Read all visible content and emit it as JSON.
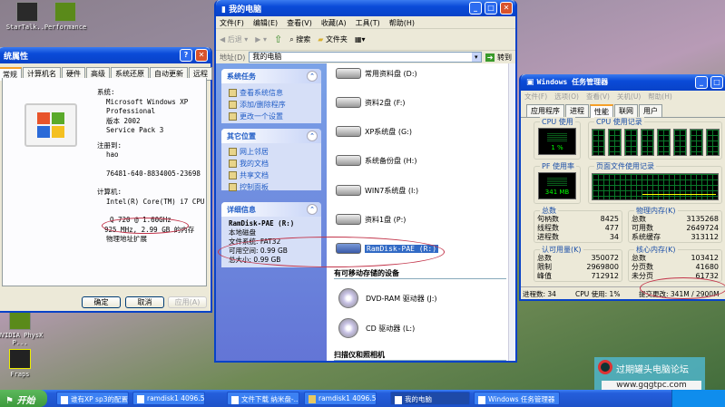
{
  "desktop": {
    "icons": [
      {
        "label": "StarTalk...",
        "icon": "startalk-shortcut-icon"
      },
      {
        "label": "Performance",
        "icon": "nvidia-performance-icon"
      },
      {
        "label": "NVIDIA PhysX P...",
        "icon": "nvidia-physx-icon"
      },
      {
        "label": "Fraps",
        "icon": "fraps-icon"
      }
    ]
  },
  "sysprops": {
    "title": "统属性",
    "tabs": [
      "常规",
      "计算机名",
      "硬件",
      "高级",
      "系统还原",
      "自动更新",
      "远程"
    ],
    "active_tab": "常规",
    "system_label": "系统:",
    "system_lines": [
      "Microsoft Windows XP",
      "Professional",
      "版本 2002",
      "Service Pack 3"
    ],
    "registered_label": "注册到:",
    "registered_user": "hao",
    "product_id": "76481-640-8834005-23698",
    "computer_label": "计算机:",
    "computer_lines": [
      "Intel(R) Core(TM) i7 CPU",
      "Q 720  @ 1.60GHz",
      "925 MHz, 2.99 GB 的内存",
      "物理地址扩展"
    ],
    "buttons": {
      "ok": "确定",
      "cancel": "取消",
      "apply": "应用(A)"
    }
  },
  "explorer": {
    "title": "我的电脑",
    "menu": [
      "文件(F)",
      "编辑(E)",
      "查看(V)",
      "收藏(A)",
      "工具(T)",
      "帮助(H)"
    ],
    "toolbar": {
      "back": "后退",
      "search": "搜索",
      "folders": "文件夹"
    },
    "address_label": "地址(D)",
    "address_value": "我的电脑",
    "go_label": "转到",
    "panels": {
      "system_tasks": {
        "title": "系统任务",
        "items": [
          "查看系统信息",
          "添加/删除程序",
          "更改一个设置"
        ]
      },
      "other_places": {
        "title": "其它位置",
        "items": [
          "网上邻居",
          "我的文档",
          "共享文档",
          "控制面板"
        ]
      },
      "details": {
        "title": "详细信息",
        "name": "RamDisk-PAE (R:)",
        "type": "本地磁盘",
        "fs": "文件系统: FAT32",
        "free": "可用空间: 0.99 GB",
        "total": "总大小: 0.99 GB"
      }
    },
    "drives": [
      "常用资料盘 (D:)",
      "资料2盘 (F:)",
      "XP系统盘 (G:)",
      "系统备份盘 (H:)",
      "WIN7系统盘 (I:)",
      "资料1盘 (P:)",
      "RamDisk-PAE (R:)"
    ],
    "selected_drive": "RamDisk-PAE (R:)",
    "removable_header": "有可移动存储的设备",
    "removable": [
      "DVD-RAM 驱动器 (J:)",
      "CD 驱动器 (L:)"
    ],
    "scanner_header": "扫描仪和照相机"
  },
  "taskmgr": {
    "title": "Windows 任务管理器",
    "menu": [
      "文件(F)",
      "选项(O)",
      "查看(V)",
      "关机(U)",
      "帮助(H)"
    ],
    "tabs": [
      "应用程序",
      "进程",
      "性能",
      "联网",
      "用户"
    ],
    "active_tab": "性能",
    "cpu_usage_label": "CPU 使用",
    "cpu_usage_value": "1 %",
    "cpu_history_label": "CPU 使用记录",
    "cpu_core_count": 8,
    "pf_usage_label": "PF 使用率",
    "pf_usage_value": "341 MB",
    "pf_history_label": "页面文件使用记录",
    "totals": {
      "title": "总数",
      "rows": [
        [
          "句柄数",
          "8425"
        ],
        [
          "线程数",
          "477"
        ],
        [
          "进程数",
          "34"
        ]
      ]
    },
    "physical": {
      "title": "物理内存(K)",
      "rows": [
        [
          "总数",
          "3135268"
        ],
        [
          "可用数",
          "2649724"
        ],
        [
          "系统缓存",
          "313112"
        ]
      ]
    },
    "commit": {
      "title": "认可用量(K)",
      "rows": [
        [
          "总数",
          "350072"
        ],
        [
          "限制",
          "2969800"
        ],
        [
          "峰值",
          "712912"
        ]
      ]
    },
    "kernel": {
      "title": "核心内存(K)",
      "rows": [
        [
          "总数",
          "103412"
        ],
        [
          "分页数",
          "41680"
        ],
        [
          "未分页",
          "61732"
        ]
      ]
    },
    "status": {
      "processes": "进程数: 34",
      "cpu": "CPU 使用: 1%",
      "commit": "提交更改: 341M / 2900M"
    }
  },
  "taskbar": {
    "start": "开始",
    "tasks": [
      "谁有XP sp3的配置...",
      "ramdisk1 4096.5 ...",
      "文件下载 纳米盘-...",
      "ramdisk1 4096.5",
      "我的电脑",
      "Windows 任务管理器"
    ],
    "active_task": "我的电脑"
  },
  "watermark": {
    "name": "过期罐头电脑论坛",
    "url": "www.gqgtpc.com"
  },
  "colors": {
    "xp_blue": "#0842c8",
    "taskbar": "#245edb",
    "start_green": "#3c9a3c",
    "annotation_red": "#c2344a",
    "graph_green": "#00ff00"
  }
}
